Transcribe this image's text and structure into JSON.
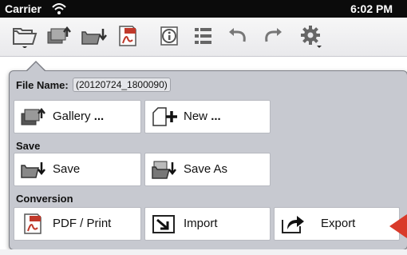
{
  "status_bar": {
    "carrier": "Carrier",
    "time": "6:02 PM"
  },
  "toolbar": {
    "icons": [
      "folder-open-icon",
      "gallery-upload-icon",
      "folder-download-icon",
      "pdf-icon",
      "info-icon",
      "list-icon",
      "undo-icon",
      "redo-icon",
      "gear-icon"
    ]
  },
  "menu": {
    "file_name_label": "File Name:",
    "file_name_value": "(20120724_1800090)",
    "gallery_label": "Gallery",
    "gallery_dots": "...",
    "new_label": "New",
    "new_dots": "...",
    "save_section": "Save",
    "save_label": "Save",
    "save_as_label": "Save As",
    "conversion_section": "Conversion",
    "pdf_print_label": "PDF / Print",
    "import_label": "Import",
    "export_label": "Export"
  },
  "colors": {
    "accent_pointer": "#d93a2a",
    "popover_bg": "#c7c9d0"
  }
}
